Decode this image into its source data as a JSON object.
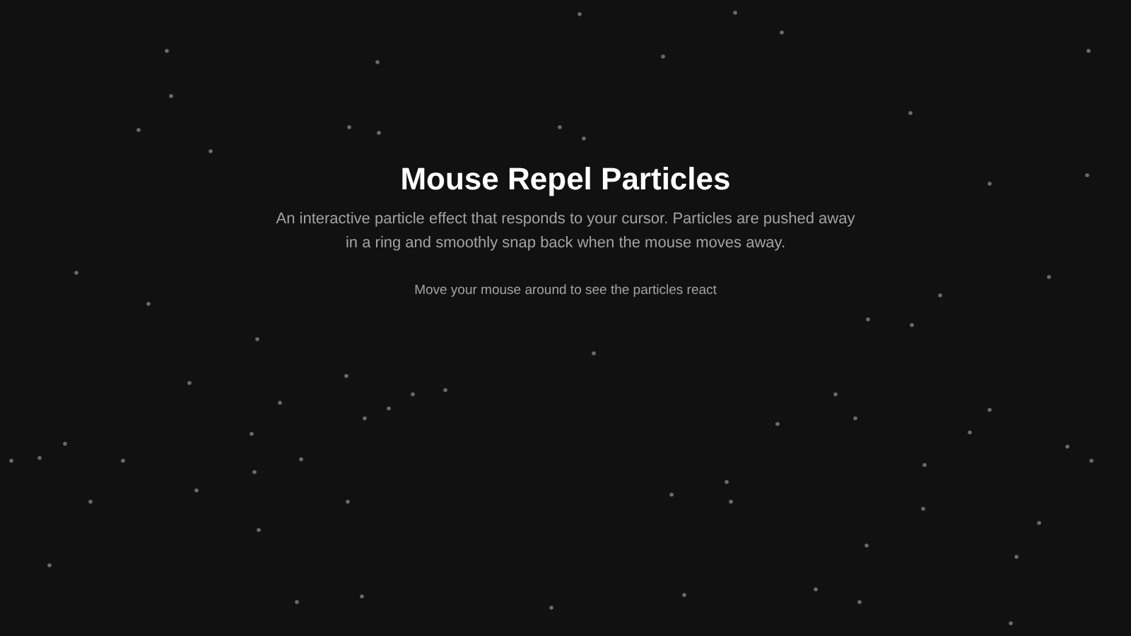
{
  "hero": {
    "title": "Mouse Repel Particles",
    "description": "An interactive particle effect that responds to your cursor. Particles are pushed away in a ring and smoothly snap back when the mouse moves away.",
    "hint": "Move your mouse around to see the particles react"
  }
}
